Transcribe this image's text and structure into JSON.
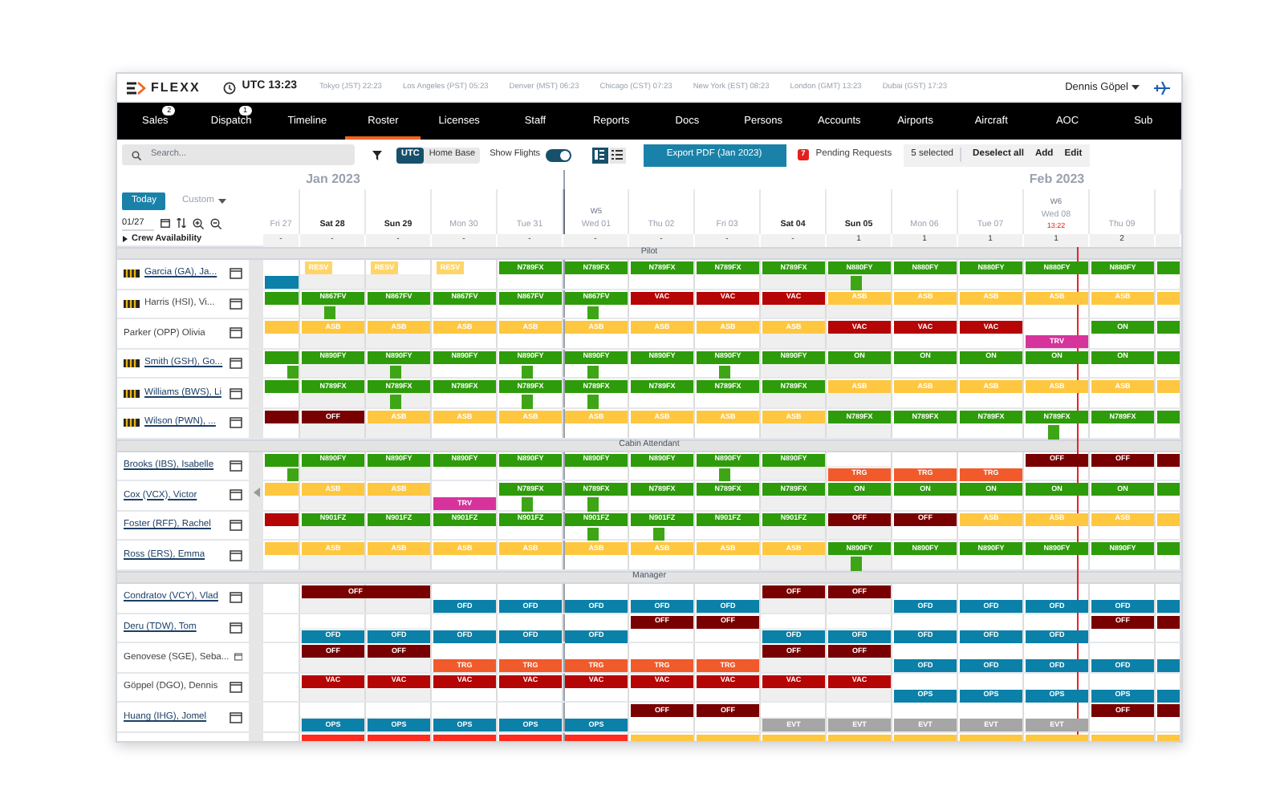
{
  "app": {
    "logo": "FLEXX",
    "clock": "UTC 13:23",
    "timezones": [
      "Tokyo (JST) 22:23",
      "Los Angeles (PST) 05:23",
      "Denver (MST) 06:23",
      "Chicago (CST) 07:23",
      "New York (EST) 08:23",
      "London (GMT) 13:23",
      "Dubai (GST) 17:23"
    ],
    "user": "Dennis Göpel"
  },
  "nav": [
    {
      "label": "Sales",
      "badge": "2",
      "selected": false
    },
    {
      "label": "Dispatch",
      "badge": "1",
      "selected": false
    },
    {
      "label": "Timeline",
      "selected": false
    },
    {
      "label": "Roster",
      "selected": true
    },
    {
      "label": "Licenses",
      "selected": false
    },
    {
      "label": "Staff",
      "selected": false
    },
    {
      "label": "Reports",
      "selected": false
    },
    {
      "label": "Docs",
      "selected": false
    },
    {
      "label": "Persons",
      "selected": false
    },
    {
      "label": "Accounts",
      "selected": false
    },
    {
      "label": "Airports",
      "selected": false
    },
    {
      "label": "Aircraft",
      "selected": false
    },
    {
      "label": "AOC",
      "selected": false
    },
    {
      "label": "Sub",
      "selected": false
    }
  ],
  "toolbar": {
    "search_placeholder": "Search...",
    "time_modes": [
      {
        "label": "UTC",
        "selected": true
      },
      {
        "label": "Home Base",
        "selected": false
      }
    ],
    "show_flights": {
      "label": "Show Flights",
      "on": true
    },
    "views": [
      {
        "kind": "columns",
        "selected": true
      },
      {
        "kind": "list",
        "selected": false
      }
    ],
    "export": "Export PDF (Jan 2023)",
    "pending": {
      "count": "7",
      "label": "Pending Requests"
    },
    "selection": {
      "count": "5 selected",
      "actions": [
        "Deselect all",
        "Add",
        "Edit"
      ]
    }
  },
  "calendar": {
    "today": "Today",
    "range": {
      "label": "Custom",
      "disabled": true
    },
    "date": "01/27",
    "availability_label": "Crew Availability",
    "expanded": false,
    "columns": [
      {
        "day": "Fri 27",
        "weekend": false,
        "availability": "-"
      },
      {
        "day": "Sat 28",
        "weekend": true,
        "month": "Jan 2023",
        "availability": "-"
      },
      {
        "day": "Sun 29",
        "weekend": true,
        "availability": "-"
      },
      {
        "day": "Mon 30",
        "weekend": false,
        "availability": "-"
      },
      {
        "day": "Tue 31",
        "weekend": false,
        "availability": "-"
      },
      {
        "day": "Wed 01",
        "weekend": false,
        "week": "W5",
        "month_start": true,
        "availability": "-"
      },
      {
        "day": "Thu 02",
        "weekend": false,
        "availability": "-"
      },
      {
        "day": "Fri 03",
        "weekend": false,
        "availability": "-"
      },
      {
        "day": "Sat 04",
        "weekend": true,
        "availability": "-"
      },
      {
        "day": "Sun 05",
        "weekend": true,
        "availability": "1"
      },
      {
        "day": "Mon 06",
        "weekend": false,
        "availability": "1"
      },
      {
        "day": "Tue 07",
        "weekend": false,
        "availability": "1"
      },
      {
        "day": "Wed 08",
        "weekend": false,
        "week": "W6",
        "month": "Feb 2023",
        "now": "13:22",
        "availability": "1"
      },
      {
        "day": "Thu 09",
        "weekend": false,
        "availability": "2"
      },
      {}
    ]
  },
  "sections": [
    {
      "title": "Pilot",
      "crew": [
        {
          "name": "Garcia (GA), Ja...",
          "captain": true,
          "linked": true,
          "previous_day": {
            "bottom": {
              "color": "#0b80a8"
            }
          },
          "days": [
            {
              "top": {
                "code": "RESV",
                "color": "#ffd56a",
                "narrow": true
              }
            },
            {
              "top": {
                "code": "RESV",
                "color": "#ffd56a",
                "narrow": true
              }
            },
            {
              "top": {
                "code": "RESV",
                "color": "#ffd56a",
                "narrow": true
              }
            },
            {
              "top": {
                "code": "N789FX",
                "color": "#2e9b0b"
              }
            },
            {
              "top": {
                "code": "N789FX",
                "color": "#2e9b0b"
              }
            },
            {
              "top": {
                "code": "N789FX",
                "color": "#2e9b0b"
              }
            },
            {
              "top": {
                "code": "N789FX",
                "color": "#2e9b0b"
              }
            },
            {
              "top": {
                "code": "N789FX",
                "color": "#2e9b0b"
              }
            },
            {
              "top": {
                "code": "N880FY",
                "color": "#2e9b0b",
                "flight": true
              }
            },
            {
              "top": {
                "code": "N880FY",
                "color": "#2e9b0b"
              }
            },
            {
              "top": {
                "code": "N880FY",
                "color": "#2e9b0b"
              }
            },
            {
              "top": {
                "code": "N880FY",
                "color": "#2e9b0b"
              }
            },
            {
              "top": {
                "code": "N880FY",
                "color": "#2e9b0b"
              }
            },
            {
              "top": {
                "color": "#2e9b0b"
              }
            }
          ]
        },
        {
          "name": "Harris (HSI), Vi...",
          "captain": true,
          "linked": false,
          "previous_day": {
            "top": {
              "color": "#2e9b0b"
            }
          },
          "days": [
            {
              "top": {
                "code": "N867FV",
                "color": "#2e9b0b",
                "flight": true
              }
            },
            {
              "top": {
                "code": "N867FV",
                "color": "#2e9b0b"
              }
            },
            {
              "top": {
                "code": "N867FV",
                "color": "#2e9b0b"
              }
            },
            {
              "top": {
                "code": "N867FV",
                "color": "#2e9b0b"
              }
            },
            {
              "top": {
                "code": "N867FV",
                "color": "#2e9b0b",
                "flight": true
              }
            },
            {
              "top": {
                "code": "VAC",
                "color": "#b50505"
              }
            },
            {
              "top": {
                "code": "VAC",
                "color": "#b50505"
              }
            },
            {
              "top": {
                "code": "VAC",
                "color": "#b50505"
              }
            },
            {
              "top": {
                "code": "ASB",
                "color": "#ffc740"
              }
            },
            {
              "top": {
                "code": "ASB",
                "color": "#ffc740"
              }
            },
            {
              "top": {
                "code": "ASB",
                "color": "#ffc740"
              }
            },
            {
              "top": {
                "code": "ASB",
                "color": "#ffc740"
              }
            },
            {
              "top": {
                "code": "ASB",
                "color": "#ffc740"
              }
            },
            {
              "top": {
                "color": "#ffc740"
              }
            }
          ]
        },
        {
          "name": "Parker (OPP) Olivia",
          "captain": false,
          "linked": false,
          "previous_day": {
            "top": {
              "color": "#ffc740"
            }
          },
          "days": [
            {
              "top": {
                "code": "ASB",
                "color": "#ffc740"
              }
            },
            {
              "top": {
                "code": "ASB",
                "color": "#ffc740"
              }
            },
            {
              "top": {
                "code": "ASB",
                "color": "#ffc740"
              }
            },
            {
              "top": {
                "code": "ASB",
                "color": "#ffc740"
              }
            },
            {
              "top": {
                "code": "ASB",
                "color": "#ffc740"
              }
            },
            {
              "top": {
                "code": "ASB",
                "color": "#ffc740"
              }
            },
            {
              "top": {
                "code": "ASB",
                "color": "#ffc740"
              }
            },
            {
              "top": {
                "code": "ASB",
                "color": "#ffc740"
              }
            },
            {
              "top": {
                "code": "VAC",
                "color": "#b50505"
              }
            },
            {
              "top": {
                "code": "VAC",
                "color": "#b50505"
              }
            },
            {
              "top": {
                "code": "VAC",
                "color": "#b50505"
              }
            },
            {
              "bottom": {
                "code": "TRV",
                "color": "#d6349c"
              }
            },
            {
              "top": {
                "code": "ON",
                "color": "#2e9b0b"
              }
            },
            {
              "top": {
                "color": "#2e9b0b"
              }
            }
          ]
        },
        {
          "name": "Smith (GSH), Go...",
          "captain": true,
          "linked": true,
          "previous_day": {
            "top": {
              "color": "#2e9b0b",
              "flight": true
            }
          },
          "days": [
            {
              "top": {
                "code": "N890FY",
                "color": "#2e9b0b"
              }
            },
            {
              "top": {
                "code": "N890FY",
                "color": "#2e9b0b",
                "flight": true
              }
            },
            {
              "top": {
                "code": "N890FY",
                "color": "#2e9b0b"
              }
            },
            {
              "top": {
                "code": "N890FY",
                "color": "#2e9b0b",
                "flight": true
              }
            },
            {
              "top": {
                "code": "N890FY",
                "color": "#2e9b0b",
                "flight": true
              }
            },
            {
              "top": {
                "code": "N890FY",
                "color": "#2e9b0b"
              }
            },
            {
              "top": {
                "code": "N890FY",
                "color": "#2e9b0b",
                "flight": true
              }
            },
            {
              "top": {
                "code": "N890FY",
                "color": "#2e9b0b"
              }
            },
            {
              "top": {
                "code": "ON",
                "color": "#2e9b0b"
              }
            },
            {
              "top": {
                "code": "ON",
                "color": "#2e9b0b"
              }
            },
            {
              "top": {
                "code": "ON",
                "color": "#2e9b0b"
              }
            },
            {
              "top": {
                "code": "ON",
                "color": "#2e9b0b"
              }
            },
            {
              "top": {
                "code": "ON",
                "color": "#2e9b0b"
              }
            },
            {
              "top": {
                "color": "#2e9b0b"
              }
            }
          ]
        },
        {
          "name": "Williams (BWS), Li",
          "captain": true,
          "linked": true,
          "previous_day": {
            "top": {
              "color": "#2e9b0b"
            }
          },
          "days": [
            {
              "top": {
                "code": "N789FX",
                "color": "#2e9b0b"
              }
            },
            {
              "top": {
                "code": "N789FX",
                "color": "#2e9b0b",
                "flight": true
              }
            },
            {
              "top": {
                "code": "N789FX",
                "color": "#2e9b0b"
              }
            },
            {
              "top": {
                "code": "N789FX",
                "color": "#2e9b0b",
                "flight": true
              }
            },
            {
              "top": {
                "code": "N789FX",
                "color": "#2e9b0b",
                "flight": true
              }
            },
            {
              "top": {
                "code": "N789FX",
                "color": "#2e9b0b"
              }
            },
            {
              "top": {
                "code": "N789FX",
                "color": "#2e9b0b"
              }
            },
            {
              "top": {
                "code": "N789FX",
                "color": "#2e9b0b"
              }
            },
            {
              "top": {
                "code": "ASB",
                "color": "#ffc740"
              }
            },
            {
              "top": {
                "code": "ASB",
                "color": "#ffc740"
              }
            },
            {
              "top": {
                "code": "ASB",
                "color": "#ffc740"
              }
            },
            {
              "top": {
                "code": "ASB",
                "color": "#ffc740"
              }
            },
            {
              "top": {
                "code": "ASB",
                "color": "#ffc740"
              }
            },
            {
              "top": {
                "color": "#ffc740"
              }
            }
          ]
        },
        {
          "name": "Wilson (PWN), ...",
          "captain": true,
          "linked": true,
          "previous_day": {
            "top": {
              "color": "#780000"
            }
          },
          "days": [
            {
              "top": {
                "code": "OFF",
                "color": "#780000"
              }
            },
            {
              "top": {
                "code": "ASB",
                "color": "#ffc740"
              }
            },
            {
              "top": {
                "code": "ASB",
                "color": "#ffc740"
              }
            },
            {
              "top": {
                "code": "ASB",
                "color": "#ffc740"
              }
            },
            {
              "top": {
                "code": "ASB",
                "color": "#ffc740"
              }
            },
            {
              "top": {
                "code": "ASB",
                "color": "#ffc740"
              }
            },
            {
              "top": {
                "code": "ASB",
                "color": "#ffc740"
              }
            },
            {
              "top": {
                "code": "ASB",
                "color": "#ffc740"
              }
            },
            {
              "top": {
                "code": "N789FX",
                "color": "#2e9b0b"
              }
            },
            {
              "top": {
                "code": "N789FX",
                "color": "#2e9b0b"
              }
            },
            {
              "top": {
                "code": "N789FX",
                "color": "#2e9b0b"
              }
            },
            {
              "top": {
                "code": "N789FX",
                "color": "#2e9b0b",
                "flight": true
              }
            },
            {
              "top": {
                "code": "N789FX",
                "color": "#2e9b0b"
              }
            },
            {
              "top": {
                "color": "#2e9b0b"
              }
            }
          ]
        }
      ]
    },
    {
      "title": "Cabin Attendant",
      "crew": [
        {
          "name": "Brooks (IBS), Isabelle",
          "captain": false,
          "linked": true,
          "previous_day": {
            "top": {
              "color": "#2e9b0b",
              "flight": true
            }
          },
          "days": [
            {
              "top": {
                "code": "N890FY",
                "color": "#2e9b0b"
              }
            },
            {
              "top": {
                "code": "N890FY",
                "color": "#2e9b0b"
              }
            },
            {
              "top": {
                "code": "N890FY",
                "color": "#2e9b0b"
              }
            },
            {
              "top": {
                "code": "N890FY",
                "color": "#2e9b0b"
              }
            },
            {
              "top": {
                "code": "N890FY",
                "color": "#2e9b0b"
              }
            },
            {
              "top": {
                "code": "N890FY",
                "color": "#2e9b0b"
              }
            },
            {
              "top": {
                "code": "N890FY",
                "color": "#2e9b0b",
                "flight": true
              }
            },
            {
              "top": {
                "code": "N890FY",
                "color": "#2e9b0b"
              }
            },
            {
              "bottom": {
                "code": "TRG",
                "color": "#f15a2b"
              }
            },
            {
              "bottom": {
                "code": "TRG",
                "color": "#f15a2b"
              }
            },
            {
              "bottom": {
                "code": "TRG",
                "color": "#f15a2b"
              }
            },
            {
              "top": {
                "code": "OFF",
                "color": "#780000"
              }
            },
            {
              "top": {
                "code": "OFF",
                "color": "#780000"
              }
            },
            {
              "top": {
                "color": "#780000"
              }
            }
          ]
        },
        {
          "name": "Cox (VCX), Victor",
          "captain": false,
          "linked": true,
          "previous_day": {
            "top": {
              "color": "#ffc740"
            }
          },
          "days": [
            {
              "top": {
                "code": "ASB",
                "color": "#ffc740"
              }
            },
            {
              "top": {
                "code": "ASB",
                "color": "#ffc740"
              }
            },
            {
              "bottom": {
                "code": "TRV",
                "color": "#d6349c"
              }
            },
            {
              "top": {
                "code": "N789FX",
                "color": "#2e9b0b",
                "flight": true
              }
            },
            {
              "top": {
                "code": "N789FX",
                "color": "#2e9b0b",
                "flight": true
              }
            },
            {
              "top": {
                "code": "N789FX",
                "color": "#2e9b0b"
              }
            },
            {
              "top": {
                "code": "N789FX",
                "color": "#2e9b0b"
              }
            },
            {
              "top": {
                "code": "N789FX",
                "color": "#2e9b0b"
              }
            },
            {
              "top": {
                "code": "ON",
                "color": "#2e9b0b"
              }
            },
            {
              "top": {
                "code": "ON",
                "color": "#2e9b0b"
              }
            },
            {
              "top": {
                "code": "ON",
                "color": "#2e9b0b"
              }
            },
            {
              "top": {
                "code": "ON",
                "color": "#2e9b0b"
              }
            },
            {
              "top": {
                "code": "ON",
                "color": "#2e9b0b"
              }
            },
            {
              "top": {
                "color": "#2e9b0b"
              }
            }
          ]
        },
        {
          "name": "Foster (RFF), Rachel",
          "captain": false,
          "linked": true,
          "previous_day": {
            "top": {
              "color": "#b50505"
            }
          },
          "days": [
            {
              "top": {
                "code": "N901FZ",
                "color": "#2e9b0b"
              }
            },
            {
              "top": {
                "code": "N901FZ",
                "color": "#2e9b0b"
              }
            },
            {
              "top": {
                "code": "N901FZ",
                "color": "#2e9b0b"
              }
            },
            {
              "top": {
                "code": "N901FZ",
                "color": "#2e9b0b"
              }
            },
            {
              "top": {
                "code": "N901FZ",
                "color": "#2e9b0b",
                "flight": true
              }
            },
            {
              "top": {
                "code": "N901FZ",
                "color": "#2e9b0b",
                "flight": true
              }
            },
            {
              "top": {
                "code": "N901FZ",
                "color": "#2e9b0b"
              }
            },
            {
              "top": {
                "code": "N901FZ",
                "color": "#2e9b0b"
              }
            },
            {
              "top": {
                "code": "OFF",
                "color": "#780000"
              }
            },
            {
              "top": {
                "code": "OFF",
                "color": "#780000"
              }
            },
            {
              "top": {
                "code": "ASB",
                "color": "#ffc740"
              }
            },
            {
              "top": {
                "code": "ASB",
                "color": "#ffc740"
              }
            },
            {
              "top": {
                "code": "ASB",
                "color": "#ffc740"
              }
            },
            {
              "top": {
                "color": "#ffc740"
              }
            }
          ]
        },
        {
          "name": "Ross (ERS), Emma",
          "captain": false,
          "linked": true,
          "previous_day": {
            "top": {
              "color": "#ffc740"
            }
          },
          "days": [
            {
              "top": {
                "code": "ASB",
                "color": "#ffc740"
              }
            },
            {
              "top": {
                "code": "ASB",
                "color": "#ffc740"
              }
            },
            {
              "top": {
                "code": "ASB",
                "color": "#ffc740"
              }
            },
            {
              "top": {
                "code": "ASB",
                "color": "#ffc740"
              }
            },
            {
              "top": {
                "code": "ASB",
                "color": "#ffc740"
              }
            },
            {
              "top": {
                "code": "ASB",
                "color": "#ffc740"
              }
            },
            {
              "top": {
                "code": "ASB",
                "color": "#ffc740"
              }
            },
            {
              "top": {
                "code": "ASB",
                "color": "#ffc740"
              }
            },
            {
              "top": {
                "code": "N890FY",
                "color": "#2e9b0b",
                "flight": true
              }
            },
            {
              "top": {
                "code": "N890FY",
                "color": "#2e9b0b"
              }
            },
            {
              "top": {
                "code": "N890FY",
                "color": "#2e9b0b"
              }
            },
            {
              "top": {
                "code": "N890FY",
                "color": "#2e9b0b"
              }
            },
            {
              "top": {
                "code": "N890FY",
                "color": "#2e9b0b"
              }
            },
            {
              "top": {
                "color": "#2e9b0b"
              }
            }
          ]
        }
      ]
    },
    {
      "title": "Manager",
      "crew": [
        {
          "name": "Condratov (VCY), Vlad",
          "captain": false,
          "linked": true,
          "days": [
            {
              "top": {
                "code": "OFF",
                "color": "#780000",
                "continues": true
              }
            },
            {
              "top": {
                "color": "#780000",
                "continued": true
              }
            },
            {
              "bottom": {
                "code": "OFD",
                "color": "#0b80a8"
              }
            },
            {
              "bottom": {
                "code": "OFD",
                "color": "#0b80a8"
              }
            },
            {
              "bottom": {
                "code": "OFD",
                "color": "#0b80a8"
              }
            },
            {
              "bottom": {
                "code": "OFD",
                "color": "#0b80a8"
              }
            },
            {
              "bottom": {
                "code": "OFD",
                "color": "#0b80a8"
              }
            },
            {
              "top": {
                "code": "OFF",
                "color": "#780000"
              }
            },
            {
              "top": {
                "code": "OFF",
                "color": "#780000"
              }
            },
            {
              "bottom": {
                "code": "OFD",
                "color": "#0b80a8"
              }
            },
            {
              "bottom": {
                "code": "OFD",
                "color": "#0b80a8"
              }
            },
            {
              "bottom": {
                "code": "OFD",
                "color": "#0b80a8"
              }
            },
            {
              "bottom": {
                "code": "OFD",
                "color": "#0b80a8"
              }
            },
            {
              "bottom": {
                "color": "#0b80a8"
              }
            }
          ]
        },
        {
          "name": "Deru (TDW), Tom",
          "captain": false,
          "linked": true,
          "days": [
            {
              "bottom": {
                "code": "OFD",
                "color": "#0b80a8"
              }
            },
            {
              "bottom": {
                "code": "OFD",
                "color": "#0b80a8"
              }
            },
            {
              "bottom": {
                "code": "OFD",
                "color": "#0b80a8"
              }
            },
            {
              "bottom": {
                "code": "OFD",
                "color": "#0b80a8"
              }
            },
            {
              "bottom": {
                "code": "OFD",
                "color": "#0b80a8"
              }
            },
            {
              "top": {
                "code": "OFF",
                "color": "#780000"
              }
            },
            {
              "top": {
                "code": "OFF",
                "color": "#780000"
              }
            },
            {
              "bottom": {
                "code": "OFD",
                "color": "#0b80a8"
              }
            },
            {
              "bottom": {
                "code": "OFD",
                "color": "#0b80a8"
              }
            },
            {
              "bottom": {
                "code": "OFD",
                "color": "#0b80a8"
              }
            },
            {
              "bottom": {
                "code": "OFD",
                "color": "#0b80a8"
              }
            },
            {
              "bottom": {
                "code": "OFD",
                "color": "#0b80a8"
              }
            },
            {
              "top": {
                "code": "OFF",
                "color": "#780000"
              }
            },
            {
              "top": {
                "color": "#780000"
              }
            }
          ]
        },
        {
          "name": "Genovese (SGE), Seba...",
          "captain": false,
          "linked": false,
          "days": [
            {
              "top": {
                "code": "OFF",
                "color": "#780000"
              }
            },
            {
              "top": {
                "code": "OFF",
                "color": "#780000"
              }
            },
            {
              "bottom": {
                "code": "TRG",
                "color": "#f15a2b"
              }
            },
            {
              "bottom": {
                "code": "TRG",
                "color": "#f15a2b"
              }
            },
            {
              "bottom": {
                "code": "TRG",
                "color": "#f15a2b"
              }
            },
            {
              "bottom": {
                "code": "TRG",
                "color": "#f15a2b"
              }
            },
            {
              "bottom": {
                "code": "TRG",
                "color": "#f15a2b"
              }
            },
            {
              "top": {
                "code": "OFF",
                "color": "#780000"
              }
            },
            {
              "top": {
                "code": "OFF",
                "color": "#780000"
              }
            },
            {
              "bottom": {
                "code": "OFD",
                "color": "#0b80a8"
              }
            },
            {
              "bottom": {
                "code": "OFD",
                "color": "#0b80a8"
              }
            },
            {
              "bottom": {
                "code": "OFD",
                "color": "#0b80a8"
              }
            },
            {
              "bottom": {
                "code": "OFD",
                "color": "#0b80a8"
              }
            },
            {
              "bottom": {
                "color": "#0b80a8"
              }
            }
          ]
        },
        {
          "name": "Göppel (DGO), Dennis",
          "captain": false,
          "linked": false,
          "days": [
            {
              "top": {
                "code": "VAC",
                "color": "#b50505"
              }
            },
            {
              "top": {
                "code": "VAC",
                "color": "#b50505"
              }
            },
            {
              "top": {
                "code": "VAC",
                "color": "#b50505"
              }
            },
            {
              "top": {
                "code": "VAC",
                "color": "#b50505"
              }
            },
            {
              "top": {
                "code": "VAC",
                "color": "#b50505"
              }
            },
            {
              "top": {
                "code": "VAC",
                "color": "#b50505"
              }
            },
            {
              "top": {
                "code": "VAC",
                "color": "#b50505"
              }
            },
            {
              "top": {
                "code": "VAC",
                "color": "#b50505"
              }
            },
            {
              "top": {
                "code": "VAC",
                "color": "#b50505"
              }
            },
            {
              "bottom": {
                "code": "OPS",
                "color": "#0b80a8"
              }
            },
            {
              "bottom": {
                "code": "OPS",
                "color": "#0b80a8"
              }
            },
            {
              "bottom": {
                "code": "OPS",
                "color": "#0b80a8"
              }
            },
            {
              "bottom": {
                "code": "OPS",
                "color": "#0b80a8"
              }
            },
            {
              "bottom": {
                "color": "#0b80a8"
              }
            }
          ]
        },
        {
          "name": "Huang (IHG), Jomel",
          "captain": false,
          "linked": true,
          "days": [
            {
              "bottom": {
                "code": "OPS",
                "color": "#0b80a8"
              }
            },
            {
              "bottom": {
                "code": "OPS",
                "color": "#0b80a8"
              }
            },
            {
              "bottom": {
                "code": "OPS",
                "color": "#0b80a8"
              }
            },
            {
              "bottom": {
                "code": "OPS",
                "color": "#0b80a8"
              }
            },
            {
              "bottom": {
                "code": "OPS",
                "color": "#0b80a8"
              }
            },
            {
              "top": {
                "code": "OFF",
                "color": "#780000"
              }
            },
            {
              "top": {
                "code": "OFF",
                "color": "#780000"
              }
            },
            {
              "bottom": {
                "code": "EVT",
                "color": "#a6a6a6"
              }
            },
            {
              "bottom": {
                "code": "EVT",
                "color": "#a6a6a6"
              }
            },
            {
              "bottom": {
                "code": "EVT",
                "color": "#a6a6a6"
              }
            },
            {
              "bottom": {
                "code": "EVT",
                "color": "#a6a6a6"
              }
            },
            {
              "bottom": {
                "code": "EVT",
                "color": "#a6a6a6"
              }
            },
            {
              "top": {
                "code": "OFF",
                "color": "#780000"
              }
            },
            {
              "top": {
                "color": "#780000"
              }
            }
          ]
        },
        {
          "captain": false,
          "days": [
            {
              "top": {
                "color": "#ff2b1c"
              }
            },
            {
              "top": {
                "color": "#ff2b1c"
              }
            },
            {
              "top": {
                "color": "#ff2b1c"
              }
            },
            {
              "top": {
                "color": "#ff2b1c"
              }
            },
            {
              "top": {
                "color": "#ff2b1c"
              }
            },
            {
              "top": {
                "color": "#ffc740"
              }
            },
            {
              "top": {
                "color": "#ffc740"
              }
            },
            {
              "top": {
                "color": "#ffc740"
              }
            },
            {
              "top": {
                "color": "#ffc740"
              }
            },
            {
              "top": {
                "color": "#ffc740"
              }
            },
            {
              "top": {
                "color": "#ffc740"
              }
            },
            {
              "top": {
                "color": "#ffc740"
              }
            },
            {
              "top": {
                "color": "#ffc740"
              }
            },
            {
              "top": {
                "color": "#ffc740"
              }
            }
          ]
        }
      ]
    }
  ]
}
